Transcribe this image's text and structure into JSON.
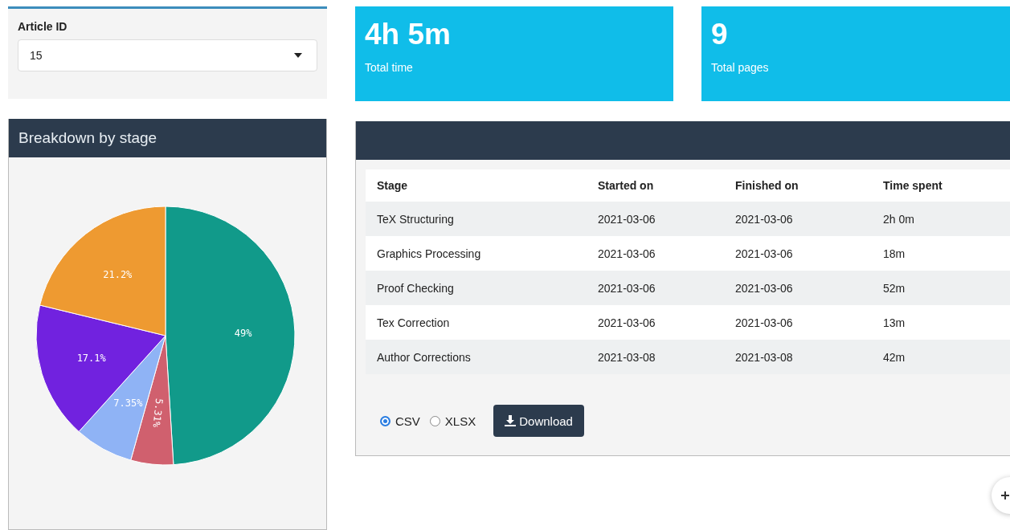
{
  "filter": {
    "label": "Article ID",
    "value": "15"
  },
  "stats": [
    {
      "value": "4h 5m",
      "label": "Total time"
    },
    {
      "value": "9",
      "label": "Total pages"
    }
  ],
  "breakdown": {
    "title": "Breakdown by stage",
    "chart_data": {
      "type": "pie",
      "values": [
        49,
        5.31,
        7.35,
        17.1,
        21.2
      ],
      "value_labels": [
        "49%",
        "5.31%",
        "7.35%",
        "17.1%",
        "21.2%"
      ],
      "colors": [
        "#119a8a",
        "#d0606e",
        "#8fb3f5",
        "#7122df",
        "#ee9a31"
      ]
    }
  },
  "table": {
    "columns": [
      "Stage",
      "Started on",
      "Finished on",
      "Time spent"
    ],
    "rows": [
      [
        "TeX Structuring",
        "2021-03-06",
        "2021-03-06",
        "2h 0m"
      ],
      [
        "Graphics Processing",
        "2021-03-06",
        "2021-03-06",
        "18m"
      ],
      [
        "Proof Checking",
        "2021-03-06",
        "2021-03-06",
        "52m"
      ],
      [
        "Tex Correction",
        "2021-03-06",
        "2021-03-06",
        "13m"
      ],
      [
        "Author Corrections",
        "2021-03-08",
        "2021-03-08",
        "42m"
      ]
    ]
  },
  "formats": [
    {
      "label": "CSV",
      "selected": true
    },
    {
      "label": "XLSX",
      "selected": false
    }
  ],
  "download": {
    "label": "Download"
  }
}
